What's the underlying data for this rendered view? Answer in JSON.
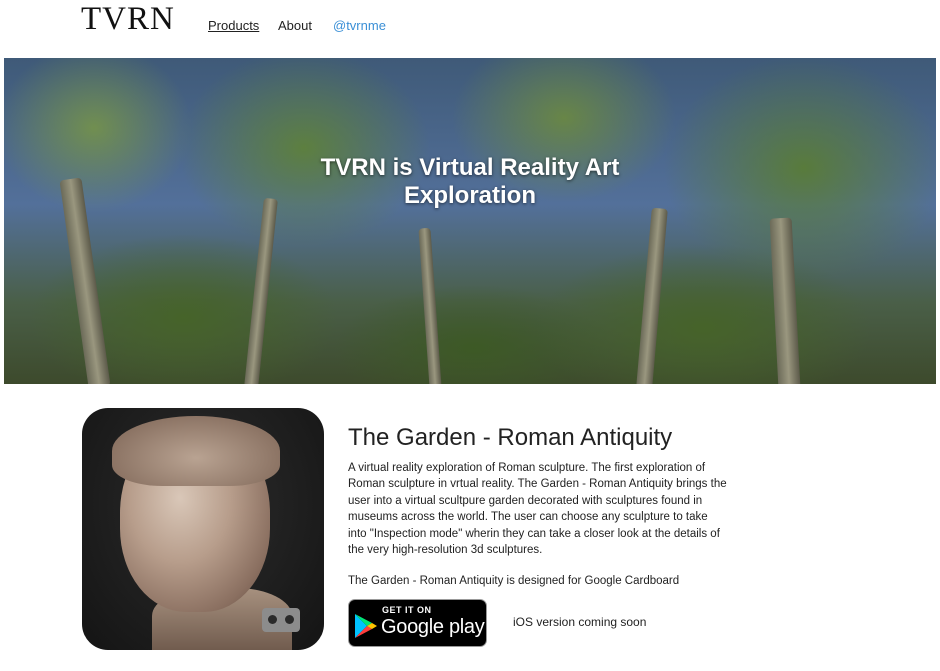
{
  "header": {
    "logo": "TVRN",
    "nav": {
      "products": "Products",
      "about": "About",
      "twitter": "@tvrnme"
    }
  },
  "hero": {
    "title_line1": "TVRN is Virtual Reality Art",
    "title_line2": "Exploration"
  },
  "product": {
    "title": "The Garden - Roman Antiquity",
    "description": "A virtual reality exploration of Roman sculpture. The first exploration of Roman sculpture in vrtual reality. The Garden - Roman Antiquity brings the user into a virtual scultpure garden decorated with sculptures found in museums across the world. The user can choose any sculpture to take into \"Inspection mode\" wherin they can take a closer look at the details of the very high-resolution 3d sculptures.",
    "cardboard_note": "The Garden - Roman Antiquity is designed for Google Cardboard",
    "google_play": {
      "top_label": "GET IT ON",
      "main_label": "Google play"
    },
    "ios_note": "iOS version coming soon"
  },
  "colors": {
    "link_blue": "#3a8fd6",
    "badge_black": "#000000"
  }
}
